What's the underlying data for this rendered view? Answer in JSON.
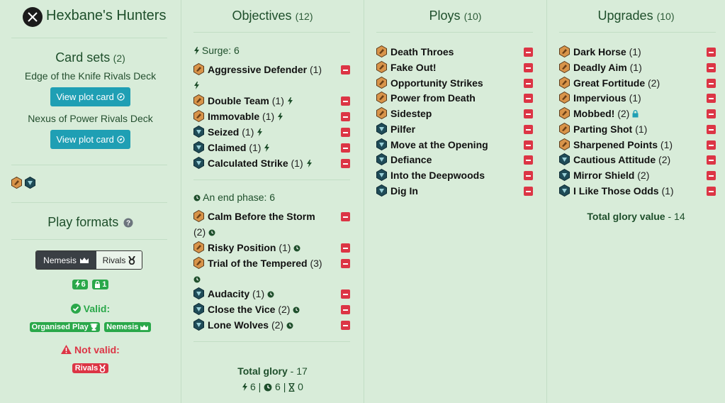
{
  "warband": {
    "name": "Hexbane's Hunters",
    "icon": "crossed-swords-icon"
  },
  "card_sets": {
    "heading": "Card sets",
    "count": "(2)",
    "decks": [
      {
        "name": "Edge of the Knife Rivals Deck",
        "button": "View plot card"
      },
      {
        "name": "Nexus of Power Rivals Deck",
        "button": "View plot card"
      }
    ]
  },
  "play_formats": {
    "heading": "Play formats",
    "options": [
      "Nemesis",
      "Rivals"
    ],
    "selected": "Nemesis",
    "surge_count": "6",
    "restricted_count": "1",
    "valid_label": "Valid:",
    "valid_badges": [
      "Organised Play",
      "Nemesis"
    ],
    "invalid_label": "Not valid:",
    "invalid_badges": [
      "Rivals"
    ]
  },
  "objectives": {
    "heading": "Objectives",
    "count": "(12)",
    "surge_label": "Surge: 6",
    "end_phase_label": "An end phase: 6",
    "surge_cards": [
      {
        "name": "Aggressive Defender",
        "glory": "(1)",
        "set": "orange"
      },
      {
        "name": "Double Team",
        "glory": "(1)",
        "set": "orange"
      },
      {
        "name": "Immovable",
        "glory": "(1)",
        "set": "orange"
      },
      {
        "name": "Seized",
        "glory": "(1)",
        "set": "teal"
      },
      {
        "name": "Claimed",
        "glory": "(1)",
        "set": "teal"
      },
      {
        "name": "Calculated Strike",
        "glory": "(1)",
        "set": "teal"
      }
    ],
    "end_cards": [
      {
        "name": "Calm Before the Storm",
        "glory": "(2)",
        "set": "orange"
      },
      {
        "name": "Risky Position",
        "glory": "(1)",
        "set": "orange"
      },
      {
        "name": "Trial of the Tempered",
        "glory": "(3)",
        "set": "orange"
      },
      {
        "name": "Audacity",
        "glory": "(1)",
        "set": "teal"
      },
      {
        "name": "Close the Vice",
        "glory": "(2)",
        "set": "teal"
      },
      {
        "name": "Lone Wolves",
        "glory": "(2)",
        "set": "teal"
      }
    ],
    "total_label": "Total glory",
    "total_value": "- 17",
    "surge_total": "6",
    "end_total": "6",
    "third_total": "0"
  },
  "ploys": {
    "heading": "Ploys",
    "count": "(10)",
    "cards": [
      {
        "name": "Death Throes",
        "set": "orange"
      },
      {
        "name": "Fake Out!",
        "set": "orange"
      },
      {
        "name": "Opportunity Strikes",
        "set": "orange"
      },
      {
        "name": "Power from Death",
        "set": "orange"
      },
      {
        "name": "Sidestep",
        "set": "orange"
      },
      {
        "name": "Pilfer",
        "set": "teal"
      },
      {
        "name": "Move at the Opening",
        "set": "teal"
      },
      {
        "name": "Defiance",
        "set": "teal"
      },
      {
        "name": "Into the Deepwoods",
        "set": "teal"
      },
      {
        "name": "Dig In",
        "set": "teal"
      }
    ]
  },
  "upgrades": {
    "heading": "Upgrades",
    "count": "(10)",
    "cards": [
      {
        "name": "Dark Horse",
        "glory": "(1)",
        "set": "orange"
      },
      {
        "name": "Deadly Aim",
        "glory": "(1)",
        "set": "orange"
      },
      {
        "name": "Great Fortitude",
        "glory": "(2)",
        "set": "orange"
      },
      {
        "name": "Impervious",
        "glory": "(1)",
        "set": "orange"
      },
      {
        "name": "Mobbed!",
        "glory": "(2)",
        "set": "orange"
      },
      {
        "name": "Parting Shot",
        "glory": "(1)",
        "set": "orange"
      },
      {
        "name": "Sharpened Points",
        "glory": "(1)",
        "set": "orange"
      },
      {
        "name": "Cautious Attitude",
        "glory": "(2)",
        "set": "teal"
      },
      {
        "name": "Mirror Shield",
        "glory": "(2)",
        "set": "teal"
      },
      {
        "name": "I Like Those Odds",
        "glory": "(1)",
        "set": "teal"
      }
    ],
    "total_label": "Total glory value",
    "total_value": "- 14"
  },
  "colors": {
    "background": "#d8ecd9",
    "heading": "#1e4f2b",
    "remove_button": "#dc3545",
    "plot_button": "#1f9fb4",
    "valid": "#2aa84a",
    "invalid": "#dc3545",
    "set_orange": "#d08a3c",
    "set_teal": "#2b6a78"
  }
}
